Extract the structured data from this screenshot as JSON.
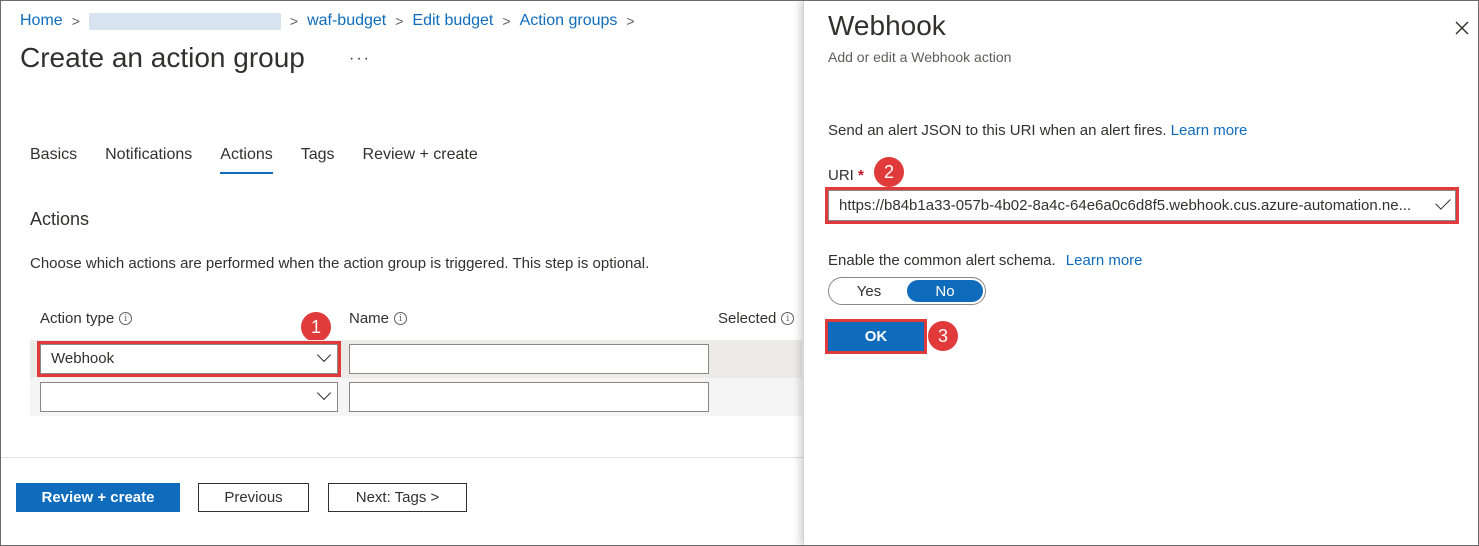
{
  "breadcrumb": {
    "home": "Home",
    "budget": "waf-budget",
    "edit": "Edit budget",
    "groups": "Action groups",
    "separator": ">"
  },
  "page": {
    "title": "Create an action group",
    "more": "···"
  },
  "tabs": [
    "Basics",
    "Notifications",
    "Actions",
    "Tags",
    "Review + create"
  ],
  "actions": {
    "title": "Actions",
    "description": "Choose which actions are performed when the action group is triggered. This step is optional.",
    "columns": [
      "Action type",
      "Name",
      "Selected"
    ],
    "rows": [
      {
        "action_type": "Webhook",
        "name": ""
      },
      {
        "action_type": "",
        "name": ""
      }
    ]
  },
  "footer": {
    "review_create": "Review + create",
    "previous": "Previous",
    "next": "Next: Tags >"
  },
  "panel": {
    "title": "Webhook",
    "subtitle": "Add or edit a Webhook action",
    "description": "Send an alert JSON to this URI when an alert fires.",
    "learn_more": "Learn more",
    "uri_label": "URI",
    "required_mark": "*",
    "uri_value": "https://b84b1a33-057b-4b02-8a4c-64e6a0c6d8f5.webhook.cus.azure-automation.ne...",
    "schema_label": "Enable the common alert schema.",
    "schema_learn_more": "Learn more",
    "toggle_yes": "Yes",
    "toggle_no": "No",
    "toggle_selected": "No",
    "ok": "OK"
  },
  "annotations": {
    "step1": "1",
    "step2": "2",
    "step3": "3"
  },
  "colors": {
    "accent": "#0f6cbd",
    "highlight": "#e03a3a"
  },
  "icons": [
    "chevron-right-icon",
    "chevron-down-icon",
    "info-icon",
    "close-icon",
    "checkmark-icon"
  ]
}
